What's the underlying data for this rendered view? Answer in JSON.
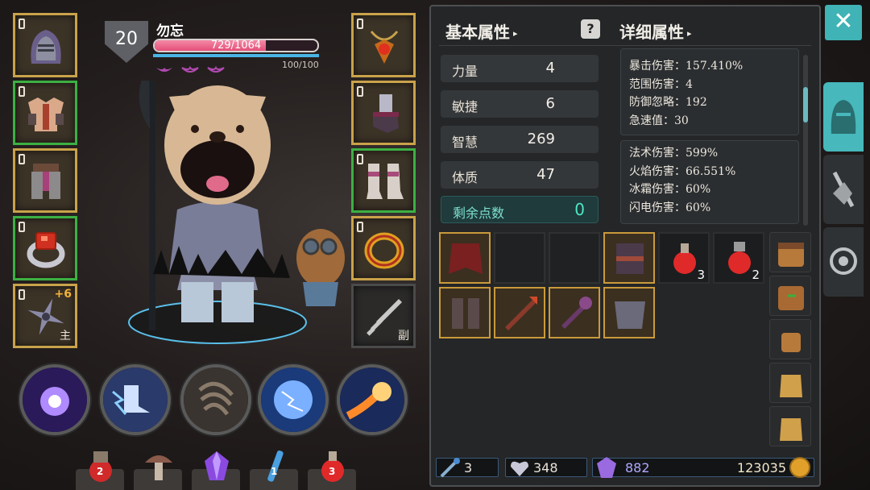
{
  "player": {
    "level": "20",
    "name": "勿忘",
    "hp_text": "729/1064",
    "hp_fraction": 0.685,
    "mp_text": "100/100",
    "mp_fraction": 1.0
  },
  "equipment_left": [
    {
      "name": "helmet",
      "icon": "helmet-icon"
    },
    {
      "name": "chest-armor",
      "icon": "armor-icon"
    },
    {
      "name": "leg-armor",
      "icon": "greaves-icon"
    },
    {
      "name": "ring",
      "icon": "ruby-ring-icon"
    },
    {
      "name": "weapon",
      "icon": "shuriken-icon",
      "plus": "+6",
      "tag": "主"
    }
  ],
  "equipment_right": [
    {
      "name": "amulet",
      "icon": "amulet-icon"
    },
    {
      "name": "gloves",
      "icon": "gauntlet-icon"
    },
    {
      "name": "boots",
      "icon": "boots-icon"
    },
    {
      "name": "ring",
      "icon": "gold-ring-icon"
    },
    {
      "name": "offhand",
      "icon": "sword-icon",
      "tag": "副"
    }
  ],
  "skills": [
    "shadow-orb-icon",
    "lightning-boots-icon",
    "claw-slash-icon",
    "lightning-sphere-icon",
    "fireball-icon"
  ],
  "consumables": [
    {
      "icon": "potion-bag-icon",
      "count": "2"
    },
    {
      "icon": "mushroom-icon",
      "count": ""
    },
    {
      "icon": "crystal-icon",
      "count": ""
    },
    {
      "icon": "blue-vial-icon",
      "count": "1"
    },
    {
      "icon": "red-potion-icon",
      "count": "3"
    }
  ],
  "panel": {
    "basic_title": "基本属性",
    "detail_title": "详细属性",
    "help": "?",
    "stats": [
      {
        "label": "力量",
        "value": "4"
      },
      {
        "label": "敏捷",
        "value": "6"
      },
      {
        "label": "智慧",
        "value": "269"
      },
      {
        "label": "体质",
        "value": "47"
      }
    ],
    "remaining": {
      "label": "剩余点数",
      "value": "0"
    },
    "detail_box1": [
      "暴击伤害：157.410%",
      "范围伤害：4",
      "防御忽略：192",
      "急速值：30"
    ],
    "detail_box2": [
      "法术伤害：599%",
      "火焰伤害：66.551%",
      "冰霜伤害：60%",
      "闪电伤害：60%"
    ]
  },
  "inventory": [
    {
      "icon": "cloak-icon",
      "frame": "gold",
      "count": ""
    },
    {
      "icon": "empty",
      "frame": "empty",
      "count": ""
    },
    {
      "icon": "empty",
      "frame": "empty",
      "count": ""
    },
    {
      "icon": "belt-armor-icon",
      "frame": "gold",
      "count": ""
    },
    {
      "icon": "health-potion-icon",
      "frame": "dark",
      "count": "3"
    },
    {
      "icon": "health-potion-icon",
      "frame": "dark",
      "count": "2"
    },
    {
      "icon": "leg-armor-icon",
      "frame": "gold",
      "count": ""
    },
    {
      "icon": "spear-icon",
      "frame": "gold",
      "count": ""
    },
    {
      "icon": "mace-icon",
      "frame": "gold",
      "count": ""
    },
    {
      "icon": "shoulder-armor-icon",
      "frame": "gold",
      "count": ""
    }
  ],
  "bags": [
    "large-bag-icon",
    "large-bag-icon",
    "small-bag-icon",
    "satchel-icon",
    "satchel-icon"
  ],
  "currency": {
    "wands": "3",
    "hearts": "348",
    "gems": "882",
    "gold": "123035"
  },
  "colors": {
    "accent": "#47b8bb",
    "gold_frame": "#c9a24a",
    "green_frame": "#3cb043",
    "hp": "#e44f78",
    "teal_value": "#4fe6c4"
  }
}
